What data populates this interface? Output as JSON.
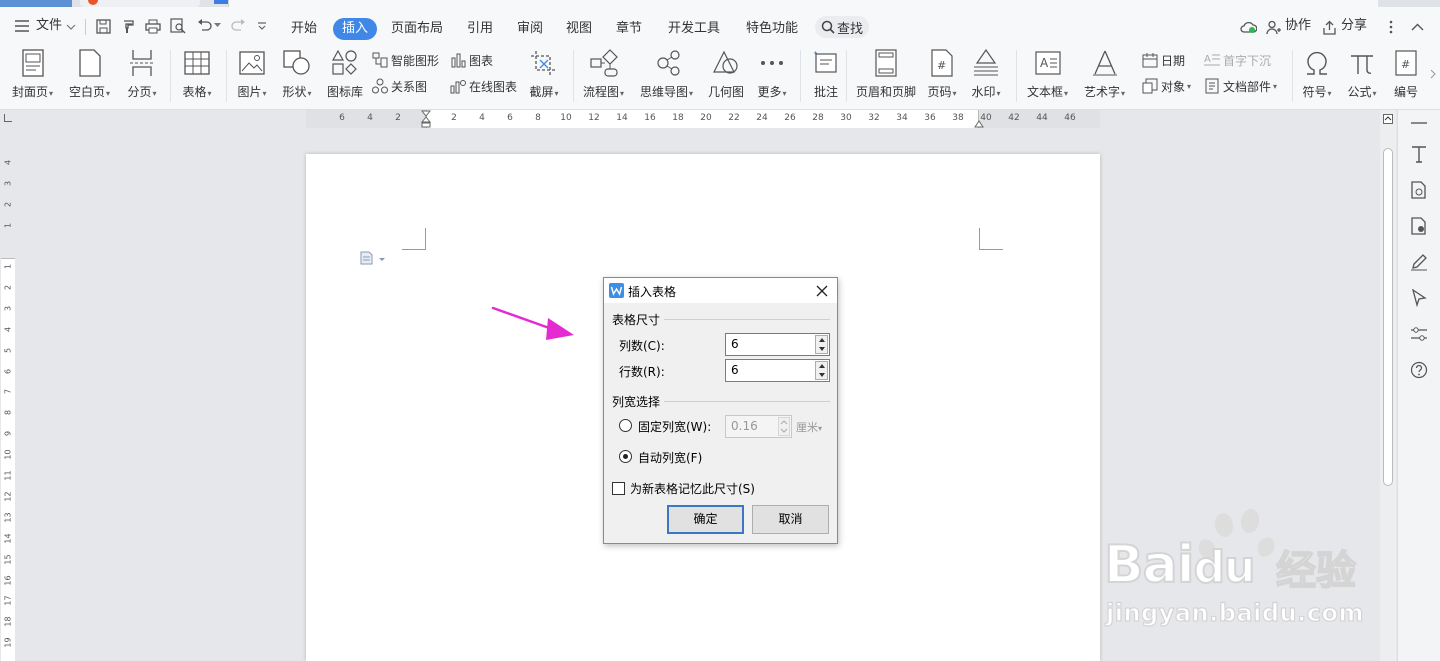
{
  "menubar": {
    "file": "文件",
    "tabs": [
      {
        "label": "开始"
      },
      {
        "label": "插入",
        "active": true
      },
      {
        "label": "页面布局"
      },
      {
        "label": "引用"
      },
      {
        "label": "审阅"
      },
      {
        "label": "视图"
      },
      {
        "label": "章节"
      },
      {
        "label": "开发工具"
      },
      {
        "label": "特色功能"
      }
    ],
    "search": "查找",
    "collab": "协作",
    "share": "分享"
  },
  "ribbon": {
    "cover": "封面页",
    "blank": "空白页",
    "pagebreak": "分页",
    "table": "表格",
    "picture": "图片",
    "shape": "形状",
    "iconlib": "图标库",
    "smartart": "智能图形",
    "chart": "图表",
    "relation": "关系图",
    "onlinechart": "在线图表",
    "screenshot": "截屏",
    "flowchart": "流程图",
    "mindmap": "思维导图",
    "geometry": "几何图",
    "more": "更多",
    "comment": "批注",
    "headerfooter": "页眉和页脚",
    "pagenum": "页码",
    "watermark": "水印",
    "textbox": "文本框",
    "wordart": "艺术字",
    "date": "日期",
    "dropcap": "首字下沉",
    "object": "对象",
    "docparts": "文档部件",
    "symbol": "符号",
    "formula": "公式",
    "numbering": "编号"
  },
  "ruler": {
    "h_left": [
      "6",
      "4",
      "2"
    ],
    "h_right": [
      "2",
      "4",
      "6",
      "8",
      "10",
      "12",
      "14",
      "16",
      "18",
      "20",
      "22",
      "24",
      "26",
      "28",
      "30",
      "32",
      "34",
      "36",
      "38",
      "40",
      "42",
      "44",
      "46"
    ],
    "v_top": [
      "4",
      "3",
      "2",
      "1"
    ],
    "v_main": [
      "1",
      "2",
      "3",
      "4",
      "5",
      "6",
      "7",
      "8",
      "9",
      "10",
      "11",
      "12",
      "13",
      "14",
      "15",
      "16",
      "17",
      "18",
      "19"
    ]
  },
  "dialog": {
    "title": "插入表格",
    "size_group": "表格尺寸",
    "cols_label": "列数(C):",
    "cols_value": "6",
    "rows_label": "行数(R):",
    "rows_value": "6",
    "width_group": "列宽选择",
    "fixed_label": "固定列宽(W):",
    "fixed_value": "0.16",
    "unit": "厘米",
    "auto_label": "自动列宽(F)",
    "remember_label": "为新表格记忆此尺寸(S)",
    "ok": "确定",
    "cancel": "取消",
    "auto_selected": true,
    "remember_checked": false
  },
  "watermark": {
    "brand": "Bai",
    "brand2": "du",
    "jingyan": "经验",
    "url": "jingyan.baidu.com"
  },
  "colors": {
    "accent": "#4088e8",
    "arrow": "#e62ad2",
    "watermark": "#d9d9d9"
  }
}
